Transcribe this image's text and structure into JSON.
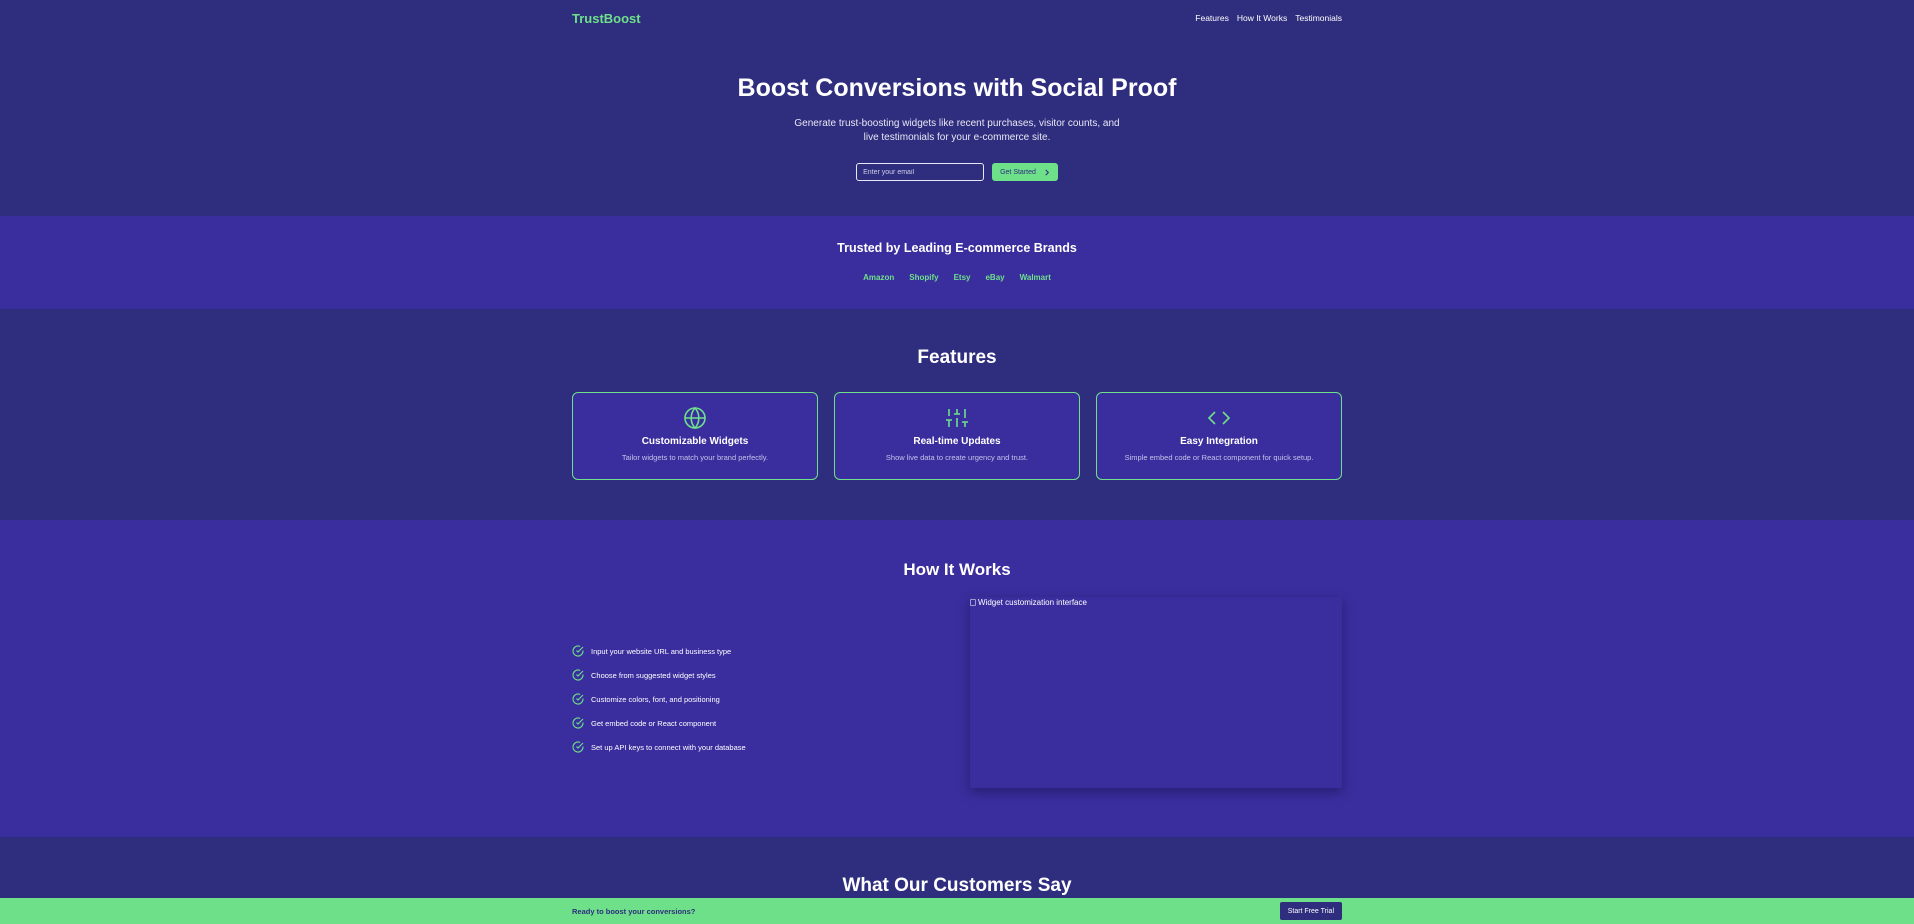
{
  "header": {
    "logo": "TrustBoost",
    "nav": [
      "Features",
      "How It Works",
      "Testimonials"
    ]
  },
  "hero": {
    "title": "Boost Conversions with Social Proof",
    "subtitle": "Generate trust-boosting widgets like recent purchases, visitor counts, and live testimonials for your e-commerce site.",
    "email_placeholder": "Enter your email",
    "cta_label": "Get Started"
  },
  "trusted": {
    "title": "Trusted by Leading E-commerce Brands",
    "brands": [
      "Amazon",
      "Shopify",
      "Etsy",
      "eBay",
      "Walmart"
    ]
  },
  "features": {
    "title": "Features",
    "cards": [
      {
        "icon": "globe-icon",
        "title": "Customizable Widgets",
        "description": "Tailor widgets to match your brand perfectly."
      },
      {
        "icon": "sliders-icon",
        "title": "Real-time Updates",
        "description": "Show live data to create urgency and trust."
      },
      {
        "icon": "code-icon",
        "title": "Easy Integration",
        "description": "Simple embed code or React component for quick setup."
      }
    ]
  },
  "how": {
    "title": "How It Works",
    "steps": [
      "Input your website URL and business type",
      "Choose from suggested widget styles",
      "Customize colors, font, and positioning",
      "Get embed code or React component",
      "Set up API keys to connect with your database"
    ],
    "image_alt": "Widget customization interface"
  },
  "testimonials": {
    "title": "What Our Customers Say"
  },
  "banner": {
    "text": "Ready to boost your conversions?",
    "button_label": "Start Free Trial"
  },
  "colors": {
    "background": "#2f2d7e",
    "section_alt": "#3a2e9e",
    "accent": "#6ee08a"
  }
}
